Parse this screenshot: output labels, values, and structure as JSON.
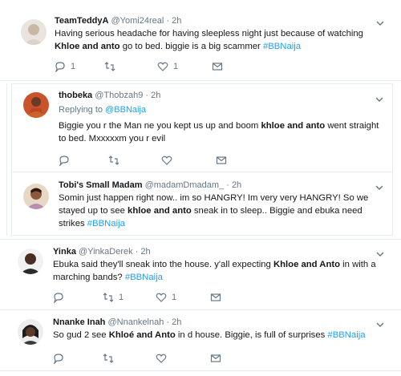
{
  "colors": {
    "accent": "#1da1f2",
    "muted": "#657786",
    "text": "#14171a",
    "border": "#e6ecf0"
  },
  "tweets": [
    {
      "name": "TeamTeddyA",
      "handle": "@Yomi24real",
      "time": "· 2h",
      "body_pre": "Having serious headache for having sleepless night just because of watching ",
      "body_bold": "Khloe and anto",
      "body_post": " go to bed. biggie is a big scammer ",
      "hashtag": "#BBNaija",
      "reply_count": "1",
      "retweet_count": "",
      "like_count": "1"
    },
    {
      "name": "thobeka",
      "handle": "@Thobzah9",
      "time": "· 2h",
      "replying_label": "Replying to",
      "replying_to": "@BBNaija",
      "body_pre": "Biggie you r the Man ne you kept us up and boom ",
      "body_bold": "khloe and anto",
      "body_post": " went straight to bed. Mxxxxxm you r evil",
      "reply_count": "",
      "retweet_count": "",
      "like_count": ""
    },
    {
      "name": "Tobi's Small Madam",
      "handle": "@madamDmadam_",
      "time": "· 2h",
      "body_pre": "Somin just happen right now.. im so HANGRY! Im very very HANGRY! So we stayed up to see ",
      "body_bold": "khloe and anto",
      "body_post": " sneak in to sleep.. Biggie and ebuka need strikes ",
      "hashtag": "#BBNaija",
      "reply_count": "",
      "retweet_count": "",
      "like_count": ""
    },
    {
      "name": "Yinka",
      "handle": "@YinkaDerek",
      "time": "· 2h",
      "body_pre": "Ebuka said they'll sneak into the house. y'all expecting ",
      "body_bold": "Khloe and Anto",
      "body_post": " in with a marching bands? ",
      "hashtag": "#BBNaija",
      "reply_count": "",
      "retweet_count": "1",
      "like_count": "1"
    },
    {
      "name": "Nnanke Inah",
      "handle": "@Nnankelnah",
      "time": "· 2h",
      "body_pre": "So gud 2 see ",
      "body_bold": "Khloé and Anto",
      "body_post": " in d house. Biggie, is full of surprises ",
      "hashtag": "#BBNaija",
      "reply_count": "",
      "retweet_count": "",
      "like_count": ""
    }
  ],
  "icons": {
    "reply": "reply-icon",
    "retweet": "retweet-icon",
    "like": "heart-icon",
    "dm": "envelope-icon",
    "caret": "chevron-down-icon"
  }
}
